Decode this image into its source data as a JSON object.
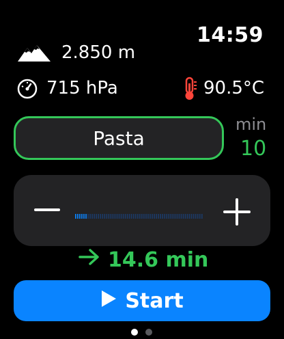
{
  "status": {
    "time": "14:59"
  },
  "altitude": {
    "icon": "mountain-icon",
    "value": "2.850 m"
  },
  "pressure": {
    "icon": "gauge-icon",
    "value": "715 hPa"
  },
  "temperature": {
    "icon": "thermometer-icon",
    "value": "90.5°C"
  },
  "food": {
    "label": "Pasta"
  },
  "base_time": {
    "unit": "min",
    "value": "10"
  },
  "adjuster": {
    "minus_icon": "minus-icon",
    "plus_icon": "plus-icon",
    "level": 0.05
  },
  "result": {
    "icon": "arrow-right-icon",
    "value": "14.6 min"
  },
  "start_button": {
    "icon": "play-icon",
    "label": "Start"
  },
  "page_indicator": {
    "count": 2,
    "active": 1
  },
  "colors": {
    "accent_green": "#34c759",
    "accent_blue": "#0a84ff",
    "panel": "#232325",
    "thermometer": "#ff453a"
  }
}
